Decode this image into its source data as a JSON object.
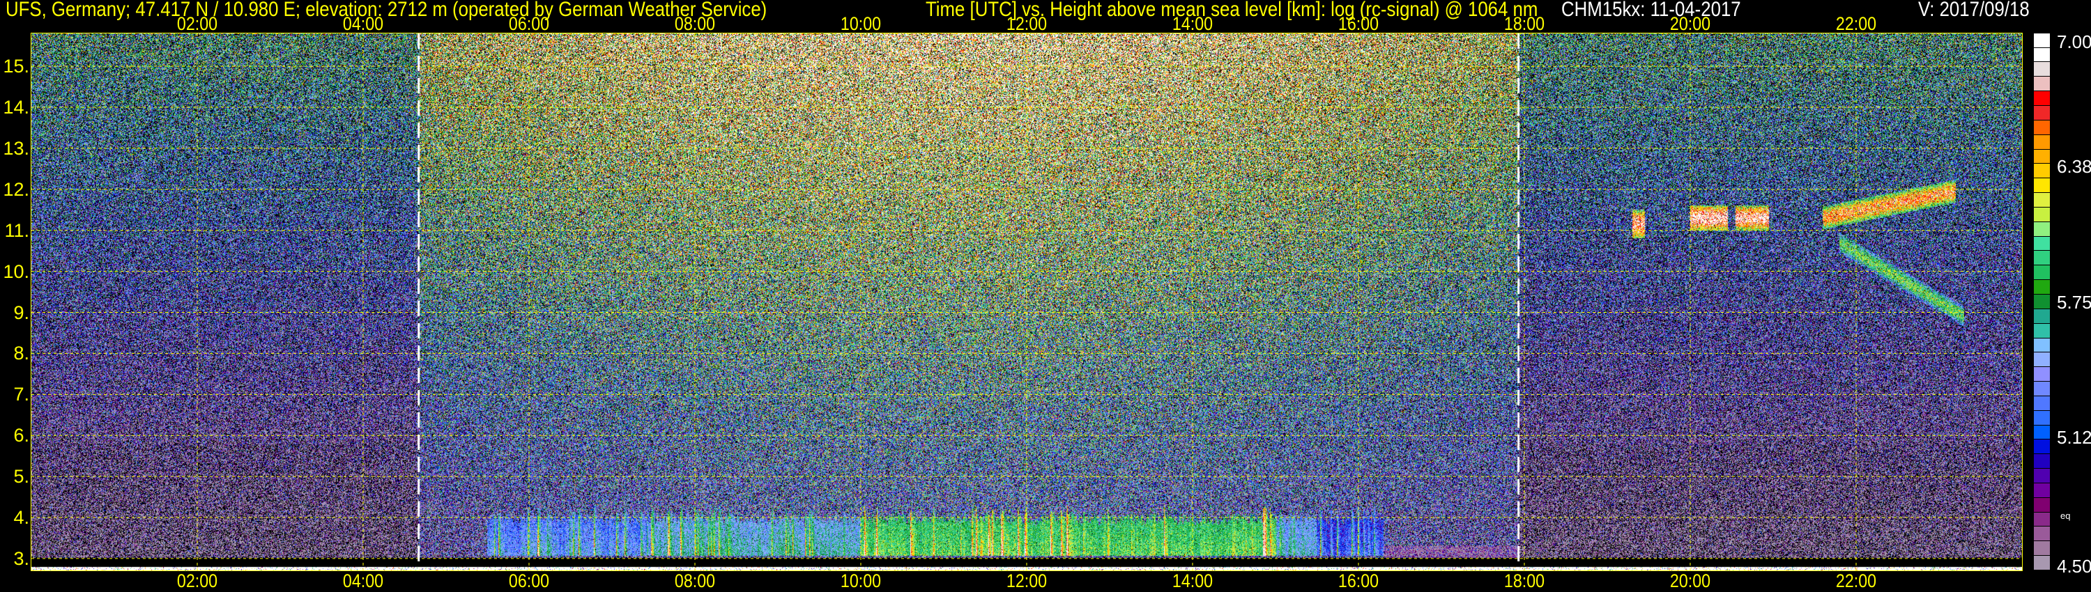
{
  "header": {
    "title": "UFS, Germany; 47.417 N / 10.980 E; elevation: 2712 m  (operated by German Weather Service)",
    "subtitle": "Time [UTC] vs. Height above mean sea level [km]: log (rc-signal) @ 1064 nm",
    "instrument_date": "CHM15kx: 11-04-2017",
    "version": "V: 2017/09/18"
  },
  "chart_data": {
    "type": "heatmap",
    "title": "Time [UTC] vs. Height above mean sea level [km]: log (rc-signal) @ 1064 nm",
    "xlabel": "Time [UTC]",
    "ylabel": "Height above mean sea level [km]",
    "xlim": [
      0,
      24
    ],
    "ylim": [
      2.71,
      15.8
    ],
    "grid": true,
    "x_ticks": [
      {
        "value": 2,
        "label": "02:00"
      },
      {
        "value": 4,
        "label": "04:00"
      },
      {
        "value": 6,
        "label": "06:00"
      },
      {
        "value": 8,
        "label": "08:00"
      },
      {
        "value": 10,
        "label": "10:00"
      },
      {
        "value": 12,
        "label": "12:00"
      },
      {
        "value": 14,
        "label": "14:00"
      },
      {
        "value": 16,
        "label": "16:00"
      },
      {
        "value": 18,
        "label": "18:00"
      },
      {
        "value": 20,
        "label": "20:00"
      },
      {
        "value": 22,
        "label": "22:00"
      }
    ],
    "y_ticks": [
      {
        "value": 3,
        "label": "3."
      },
      {
        "value": 4,
        "label": "4."
      },
      {
        "value": 5,
        "label": "5."
      },
      {
        "value": 6,
        "label": "6."
      },
      {
        "value": 7,
        "label": "7."
      },
      {
        "value": 8,
        "label": "8."
      },
      {
        "value": 9,
        "label": "9."
      },
      {
        "value": 10,
        "label": "10."
      },
      {
        "value": 11,
        "label": "11."
      },
      {
        "value": 12,
        "label": "12."
      },
      {
        "value": 13,
        "label": "13."
      },
      {
        "value": 14,
        "label": "14."
      },
      {
        "value": 15,
        "label": "15."
      }
    ],
    "day_markers_utc": [
      4.67,
      17.93
    ],
    "colorbar": {
      "min": 4.5,
      "max": 7.0,
      "ticks": [
        {
          "value": 7.0,
          "label": "7.00"
        },
        {
          "value": 6.38,
          "label": "6.38"
        },
        {
          "value": 5.75,
          "label": "5.75"
        },
        {
          "value": 5.12,
          "label": "5.12"
        },
        {
          "value": 4.5,
          "label": "4.50"
        }
      ],
      "note": "eq",
      "colors_low_to_high": [
        "#a898b0",
        "#a07aa0",
        "#9a5a9a",
        "#8a2a8a",
        "#800070",
        "#7000a0",
        "#5000b0",
        "#2000c0",
        "#0010e0",
        "#0060ff",
        "#3070ff",
        "#5078ff",
        "#7088ff",
        "#9090ff",
        "#90b0ff",
        "#80c0ff",
        "#30c0a8",
        "#20a890",
        "#109030",
        "#20a810",
        "#20c060",
        "#30d080",
        "#40e0a0",
        "#90f080",
        "#c8f040",
        "#e0f040",
        "#ffe600",
        "#ffcc00",
        "#ffb000",
        "#ff9900",
        "#ff6600",
        "#f02828",
        "#ff0000",
        "#ecc0c0",
        "#e8dede",
        "#ffffff",
        "#ffffff"
      ]
    },
    "features": [
      {
        "kind": "cloud",
        "t": [
          19.3,
          19.45
        ],
        "h_center": [
          11.15,
          11.15
        ],
        "half_thickness": 0.35,
        "peak": 6.8
      },
      {
        "kind": "cloud",
        "t": [
          20.0,
          20.45
        ],
        "h_center": [
          11.3,
          11.3
        ],
        "half_thickness": 0.3,
        "peak": 6.9
      },
      {
        "kind": "cloud",
        "t": [
          20.55,
          20.95
        ],
        "h_center": [
          11.3,
          11.3
        ],
        "half_thickness": 0.3,
        "peak": 6.85
      },
      {
        "kind": "cloud",
        "t": [
          21.6,
          23.2
        ],
        "h_center": [
          11.3,
          11.95
        ],
        "half_thickness": 0.28,
        "peak": 6.6
      },
      {
        "kind": "cloud",
        "t": [
          21.8,
          23.3
        ],
        "h_center": [
          10.7,
          8.9
        ],
        "half_thickness": 0.25,
        "peak": 6.0
      },
      {
        "kind": "boundary_layer",
        "t": [
          5.5,
          16.3
        ],
        "h_top": 4.0
      }
    ]
  }
}
